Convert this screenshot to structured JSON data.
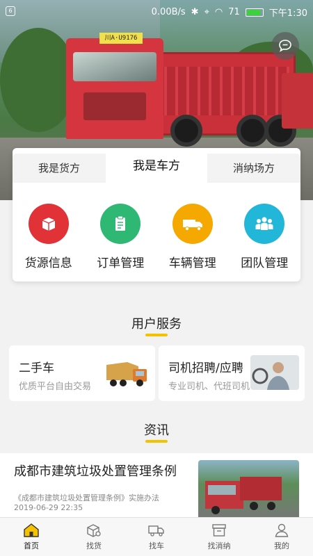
{
  "status_bar": {
    "speed": "0.00B/s",
    "battery_pct": "71",
    "time": "下午1:30"
  },
  "hero": {
    "plate_text": "川A·U9176"
  },
  "role_tabs": [
    "我是货方",
    "我是车方",
    "消纳场方"
  ],
  "role_active_index": 1,
  "role_actions": [
    {
      "label": "货源信息",
      "icon": "box-icon",
      "color": "#e13237"
    },
    {
      "label": "订单管理",
      "icon": "clipboard-icon",
      "color": "#2fb873"
    },
    {
      "label": "车辆管理",
      "icon": "truck-icon",
      "color": "#f5a800"
    },
    {
      "label": "团队管理",
      "icon": "team-icon",
      "color": "#22b6d8"
    }
  ],
  "user_services": {
    "title": "用户服务",
    "items": [
      {
        "title": "二手车",
        "subtitle": "优质平台自由交易"
      },
      {
        "title": "司机招聘/应聘",
        "subtitle": "专业司机、代班司机"
      }
    ]
  },
  "news": {
    "title": "资讯",
    "items": [
      {
        "headline": "成都市建筑垃圾处置管理条例",
        "summary": "《成都市建筑垃圾处置管理条例》实施办法",
        "date": "2019-06-29 22:35"
      }
    ]
  },
  "bottom_nav": [
    {
      "label": "首页",
      "icon": "home-icon",
      "active": true
    },
    {
      "label": "找货",
      "icon": "find-cargo-icon",
      "active": false
    },
    {
      "label": "找车",
      "icon": "find-truck-icon",
      "active": false
    },
    {
      "label": "找消纳",
      "icon": "find-disposal-icon",
      "active": false
    },
    {
      "label": "我的",
      "icon": "profile-icon",
      "active": false
    }
  ],
  "colors": {
    "accent": "#f5c200"
  }
}
